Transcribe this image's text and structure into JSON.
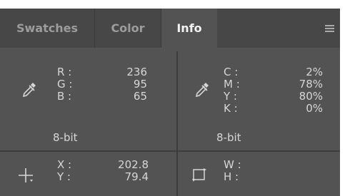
{
  "tabs": [
    {
      "label": "Swatches",
      "active": false
    },
    {
      "label": "Color",
      "active": false
    },
    {
      "label": "Info",
      "active": true
    }
  ],
  "menu_icon": "panel-menu-icon",
  "rgb": {
    "labels": {
      "r": "R :",
      "g": "G :",
      "b": "B :"
    },
    "values": {
      "r": "236",
      "g": "95",
      "b": "65"
    },
    "mode": "8-bit",
    "icon": "eyedropper-icon"
  },
  "cmyk": {
    "labels": {
      "c": "C :",
      "m": "M :",
      "y": "Y :",
      "k": "K :"
    },
    "values": {
      "c": "2%",
      "m": "78%",
      "y": "80%",
      "k": "0%"
    },
    "mode": "8-bit",
    "icon": "eyedropper-icon"
  },
  "position": {
    "labels": {
      "x": "X :",
      "y": "Y :"
    },
    "values": {
      "x": "202.8",
      "y": "79.4"
    },
    "icon": "crosshair-icon"
  },
  "size": {
    "labels": {
      "w": "W :",
      "h": "H :"
    },
    "values": {
      "w": "",
      "h": ""
    },
    "icon": "selection-size-icon"
  },
  "colors": {
    "panel_bg": "#535353",
    "tabbar_bg": "#474747",
    "text": "#d6d6d6",
    "active_tab_text": "#f2f2f2"
  }
}
